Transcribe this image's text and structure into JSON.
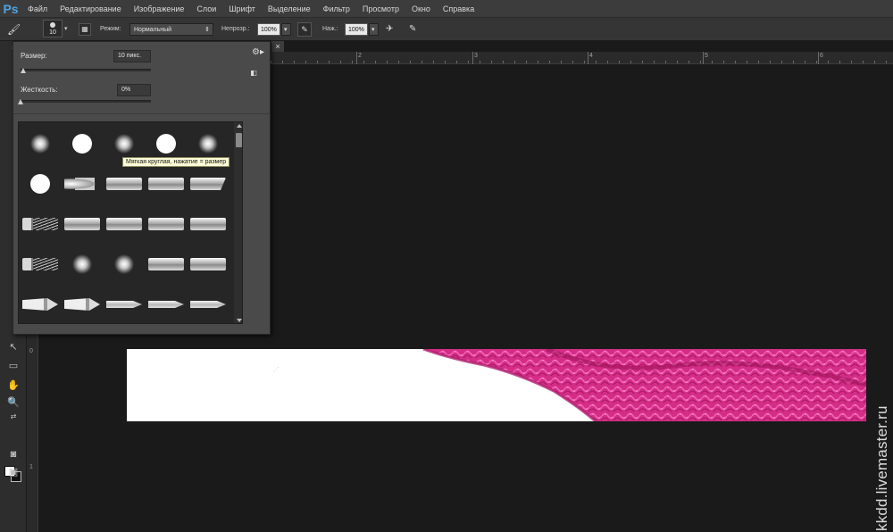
{
  "app": {
    "logo": "Ps"
  },
  "menu": [
    "Файл",
    "Редактирование",
    "Изображение",
    "Слои",
    "Шрифт",
    "Выделение",
    "Фильтр",
    "Просмотр",
    "Окно",
    "Справка"
  ],
  "options_bar": {
    "brush_size_preview": "10",
    "mode_label": "Режим:",
    "mode_value": "Нормальный",
    "opacity_label": "Непрозр.:",
    "opacity_value": "100%",
    "flow_label": "Наж.:",
    "flow_value": "100%"
  },
  "brush_panel": {
    "size_label": "Размер:",
    "size_value": "10 пикс.",
    "size_fraction": 0.02,
    "hardness_label": "Жесткость:",
    "hardness_value": "0%",
    "hardness_fraction": 0.0,
    "tooltip": "Мягкая круглая, нажатие = размер",
    "presets": [
      [
        "soft-round",
        "hard-round",
        "soft-round",
        "hard-round",
        "soft-round"
      ],
      [
        "hard-round",
        "round-bristle",
        "flat-bristle",
        "flat-bristle",
        "angled-bristle"
      ],
      [
        "fan-bristle",
        "flat-bristle",
        "flat-bristle",
        "flat-bristle",
        "flat-bristle"
      ],
      [
        "fan-bristle",
        "soft-round",
        "soft-round",
        "flat-bristle",
        "flat-bristle"
      ],
      [
        "pencil-tip",
        "pencil-tip",
        "airbrush-pen",
        "airbrush-pen",
        "airbrush-pen"
      ]
    ]
  },
  "rulers": {
    "horizontal": [
      "2",
      "3",
      "4",
      "5",
      "6"
    ],
    "vertical": [
      "0",
      "1"
    ]
  },
  "document": {
    "close_glyph": "×"
  },
  "colors": {
    "foreground": "#ffffff",
    "background": "#111111",
    "yarn": "#e0308f"
  },
  "watermark": "kkdd.livemaster.ru"
}
